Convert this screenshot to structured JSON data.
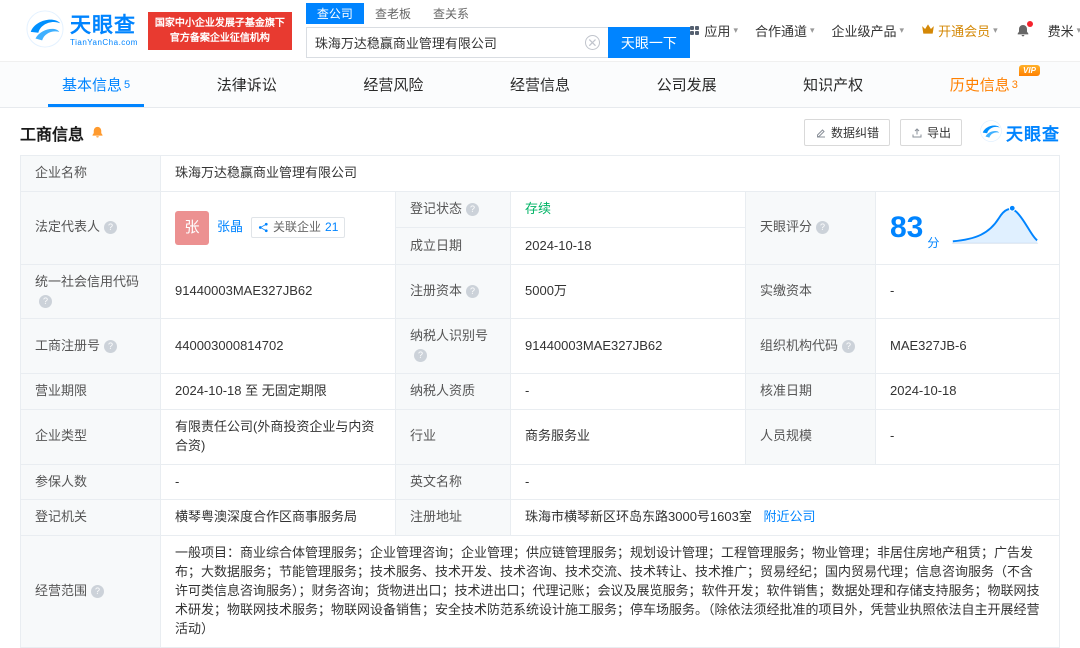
{
  "colors": {
    "accent_blue": "#0084ff",
    "brand_red": "#e83a30",
    "status_green": "#00b365",
    "history_orange": "#ff8000",
    "avatar_pink": "#ec9191"
  },
  "header": {
    "logo": {
      "cn": "天眼查",
      "en": "TianYanCha.com"
    },
    "gov_badge": {
      "line1": "国家中小企业发展子基金旗下",
      "line2": "官方备案企业征信机构"
    },
    "search": {
      "tabs": [
        {
          "label": "查公司"
        },
        {
          "label": "查老板"
        },
        {
          "label": "查关系"
        }
      ],
      "value": "珠海万达稳赢商业管理有限公司",
      "button": "天眼一下"
    },
    "nav": {
      "apps": "应用",
      "cooperation": "合作通道",
      "enterprise": "企业级产品",
      "member": "开通会员",
      "user": "费米"
    }
  },
  "tabs": {
    "basic": {
      "label": "基本信息",
      "count": "5"
    },
    "legal": {
      "label": "法律诉讼"
    },
    "risk": {
      "label": "经营风险"
    },
    "operation": {
      "label": "经营信息"
    },
    "development": {
      "label": "公司发展"
    },
    "ip": {
      "label": "知识产权"
    },
    "history": {
      "label": "历史信息",
      "count": "3",
      "vip": "VIP"
    }
  },
  "section": {
    "title": "工商信息",
    "correct_btn": "数据纠错",
    "export_btn": "导出",
    "watermark": "天眼查"
  },
  "fields": {
    "company_name": {
      "label": "企业名称",
      "value": "珠海万达稳赢商业管理有限公司"
    },
    "legal_rep": {
      "label": "法定代表人",
      "avatar": "张",
      "name": "张晶",
      "related_label": "关联企业",
      "related_count": "21"
    },
    "reg_status": {
      "label": "登记状态",
      "value": "存续"
    },
    "score": {
      "label": "天眼评分",
      "value": "83",
      "unit": "分"
    },
    "est_date": {
      "label": "成立日期",
      "value": "2024-10-18"
    },
    "credit_code": {
      "label": "统一社会信用代码",
      "value": "91440003MAE327JB62"
    },
    "reg_capital": {
      "label": "注册资本",
      "value": "5000万"
    },
    "paid_capital": {
      "label": "实缴资本",
      "value": "-"
    },
    "reg_number": {
      "label": "工商注册号",
      "value": "440003000814702"
    },
    "taxpayer_id": {
      "label": "纳税人识别号",
      "value": "91440003MAE327JB62"
    },
    "org_code": {
      "label": "组织机构代码",
      "value": "MAE327JB-6"
    },
    "business_term": {
      "label": "营业期限",
      "value": "2024-10-18 至 无固定期限"
    },
    "taxpayer_quality": {
      "label": "纳税人资质",
      "value": "-"
    },
    "approval_date": {
      "label": "核准日期",
      "value": "2024-10-18"
    },
    "company_type": {
      "label": "企业类型",
      "value": "有限责任公司(外商投资企业与内资合资)"
    },
    "industry": {
      "label": "行业",
      "value": "商务服务业"
    },
    "staff_size": {
      "label": "人员规模",
      "value": "-"
    },
    "insured_count": {
      "label": "参保人数",
      "value": "-"
    },
    "english_name": {
      "label": "英文名称",
      "value": "-"
    },
    "reg_authority": {
      "label": "登记机关",
      "value": "横琴粤澳深度合作区商事服务局"
    },
    "reg_address": {
      "label": "注册地址",
      "value": "珠海市横琴新区环岛东路3000号1603室",
      "link": "附近公司"
    },
    "business_scope": {
      "label": "经营范围",
      "value": "一般项目：商业综合体管理服务；企业管理咨询；企业管理；供应链管理服务；规划设计管理；工程管理服务；物业管理；非居住房地产租赁；广告发布；大数据服务；节能管理服务；技术服务、技术开发、技术咨询、技术交流、技术转让、技术推广；贸易经纪；国内贸易代理；信息咨询服务（不含许可类信息咨询服务）；财务咨询；货物进出口；技术进出口；代理记账；会议及展览服务；软件开发；软件销售；数据处理和存储支持服务；物联网技术研发；物联网技术服务；物联网设备销售；安全技术防范系统设计施工服务；停车场服务。（除依法须经批准的项目外，凭营业执照依法自主开展经营活动）"
    }
  },
  "icons": {
    "help": "?",
    "caret": "▾",
    "clear": "✕"
  }
}
